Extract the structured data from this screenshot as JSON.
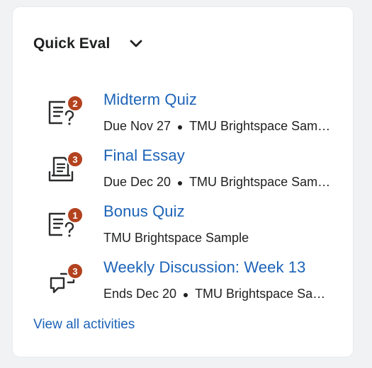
{
  "widget": {
    "title": "Quick Eval",
    "chevron_icon": "chevron-down-icon"
  },
  "activities": [
    {
      "icon": "quiz-icon",
      "badge": "2",
      "title": "Midterm Quiz",
      "due": "Due Nov 27",
      "course": "TMU Brightspace Sample"
    },
    {
      "icon": "assignment-dropbox-icon",
      "badge": "3",
      "title": "Final Essay",
      "due": "Due Dec 20",
      "course": "TMU Brightspace Sample"
    },
    {
      "icon": "quiz-icon",
      "badge": "1",
      "title": "Bonus Quiz",
      "due": "",
      "course": "TMU Brightspace Sample"
    },
    {
      "icon": "discussion-icon",
      "badge": "3",
      "title": "Weekly Discussion: Week 13",
      "due": "Ends Dec 20",
      "course": "TMU Brightspace Sample"
    }
  ],
  "footer": {
    "view_all_label": "View all activities"
  },
  "colors": {
    "link": "#1c63b7",
    "badge": "#b3421f",
    "text": "#202122"
  }
}
